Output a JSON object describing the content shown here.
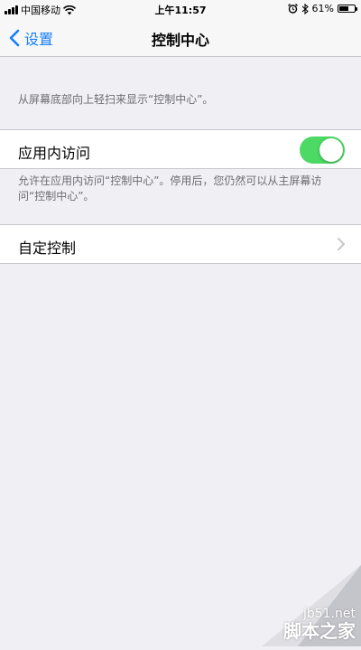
{
  "status_bar": {
    "carrier": "中国移动",
    "time": "上午11:57",
    "battery_text": "61%",
    "battery_level": 0.61
  },
  "nav": {
    "back_label": "设置",
    "title": "控制中心",
    "accent_color": "#147efb"
  },
  "top_hint": "从屏幕底部向上轻扫来显示“控制中心”。",
  "access_in_apps": {
    "label": "应用内访问",
    "enabled": true,
    "toggle_color": "#4cd964",
    "footer": "允许在应用内访问“控制中心”。停用后，您仍然可以从主屏幕访问“控制中心”。"
  },
  "customize": {
    "label": "自定控制"
  },
  "watermark": {
    "url": "jb51.net",
    "name": "脚本之家"
  }
}
